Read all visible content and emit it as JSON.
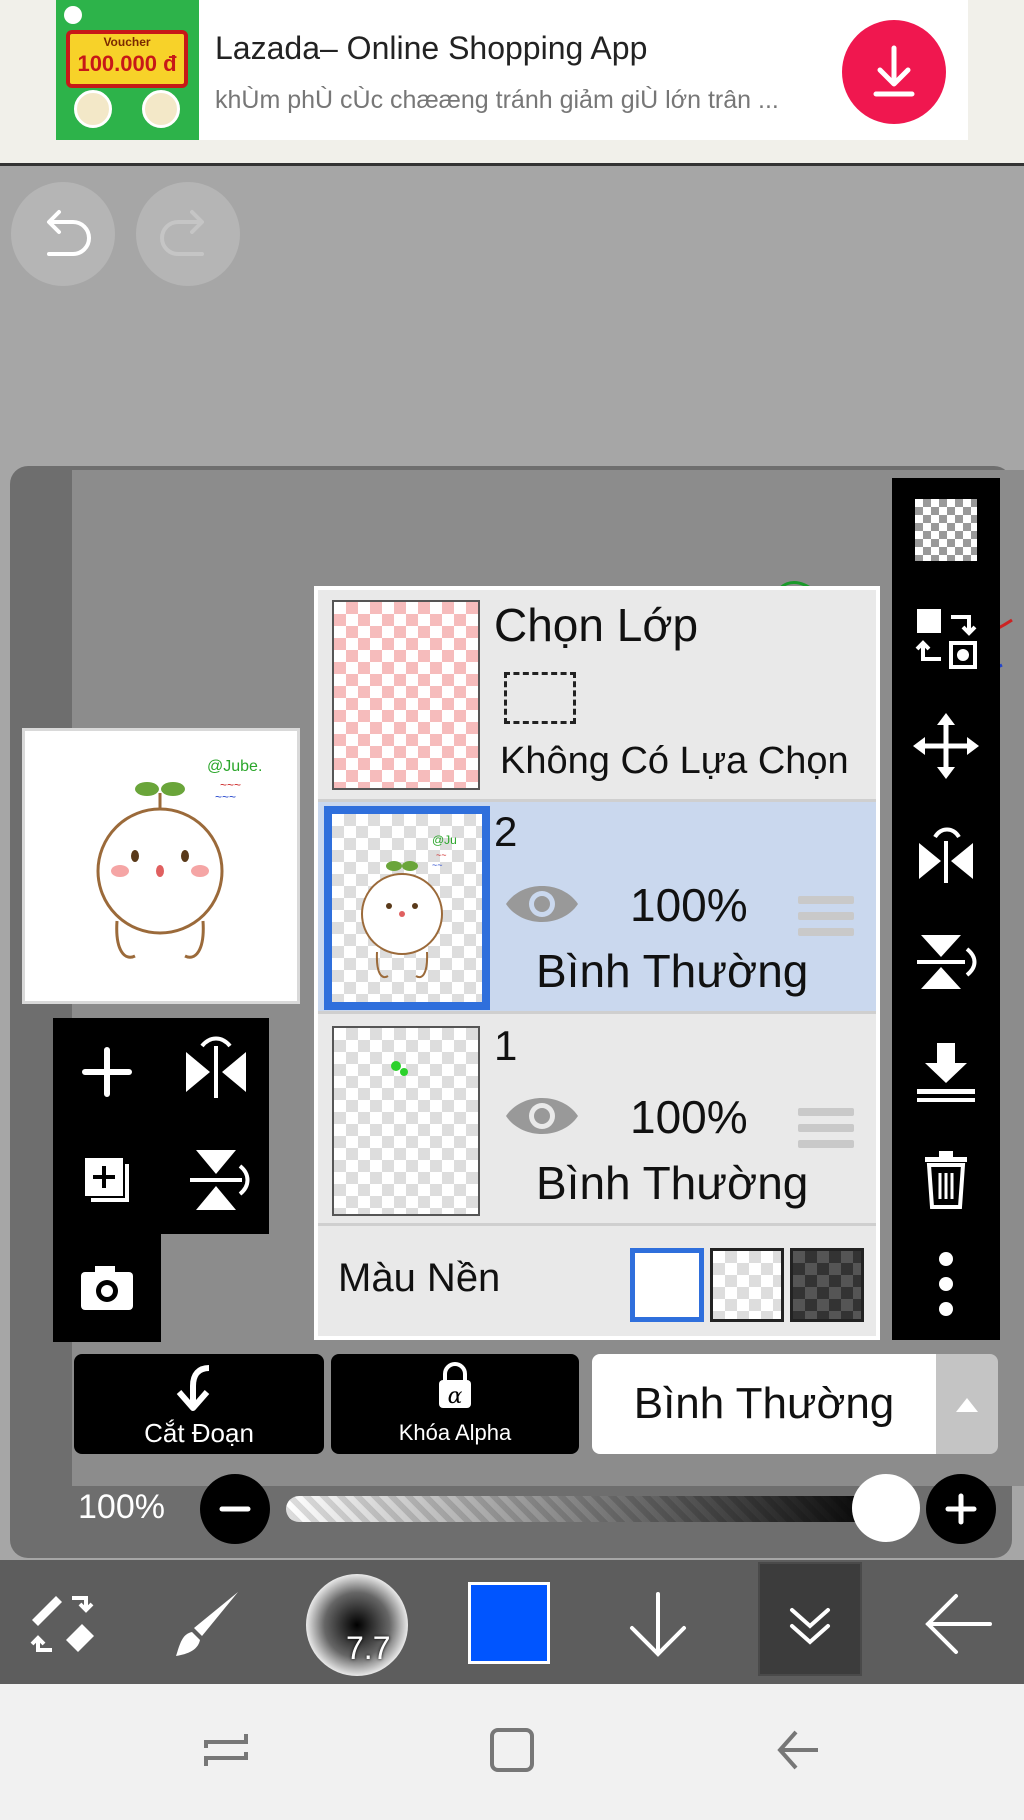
{
  "ad": {
    "title": "Lazada– Online Shopping App",
    "subtitle": "khÙm phÙ cÙc chææng tránh giảm giÙ lớn trân ...",
    "voucher_label": "Voucher",
    "voucher_amount": "100.000 đ",
    "accent": "#f0174f"
  },
  "toolbar_top": {
    "undo_icon": "undo-icon",
    "redo_icon": "redo-icon"
  },
  "layers": {
    "selection_layer": {
      "title": "Chọn Lớp",
      "status": "Không Có Lựa Chọn"
    },
    "items": [
      {
        "name": "2",
        "opacity": "100%",
        "blend": "Bình Thường",
        "selected": true
      },
      {
        "name": "1",
        "opacity": "100%",
        "blend": "Bình Thường",
        "selected": false
      }
    ],
    "background": {
      "label": "Màu Nền",
      "options": [
        "white",
        "transparent",
        "dark"
      ],
      "selected": "white"
    }
  },
  "actions": {
    "clip_label": "Cắt Đoạn",
    "alpha_lock_label": "Khóa Alpha",
    "blend_mode_value": "Bình Thường"
  },
  "opacity": {
    "label": "100%",
    "value": 1.0
  },
  "bottom_toolbar": {
    "brush_size": "7.7",
    "current_color": "#0055ff"
  },
  "colors": {
    "selected_layer_bg": "#cad8ee",
    "selected_layer_border": "#2f6fdc"
  }
}
